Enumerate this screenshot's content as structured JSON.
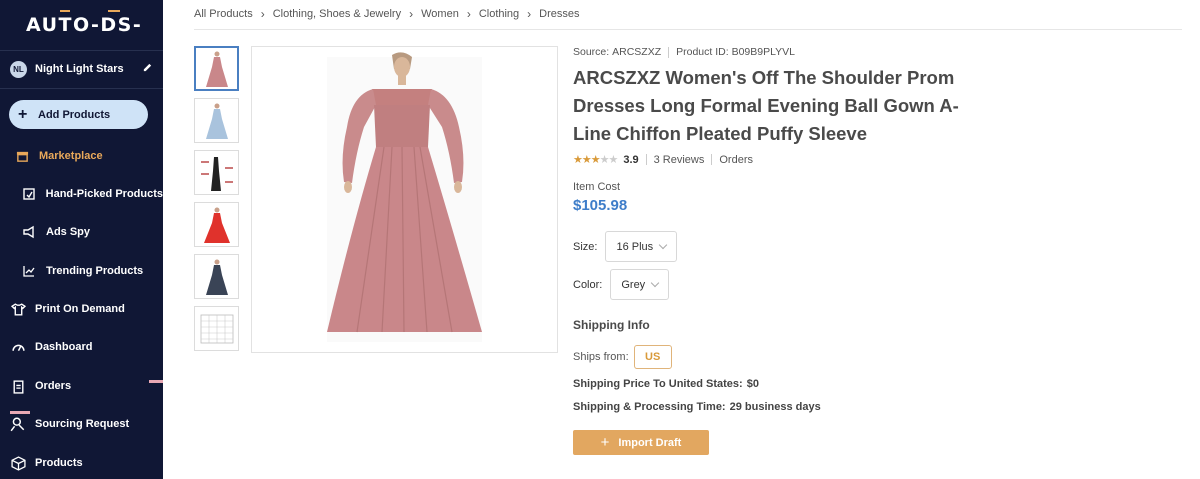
{
  "sidebar": {
    "logo": "AUTO-DS-",
    "store": {
      "initials": "NL",
      "name": "Night Light Stars"
    },
    "add_products": "Add Products",
    "items": [
      {
        "label": "Marketplace",
        "icon": "store-icon",
        "active": true
      },
      {
        "label": "Hand-Picked Products",
        "icon": "hand-picked-icon"
      },
      {
        "label": "Ads Spy",
        "icon": "megaphone-icon"
      },
      {
        "label": "Trending Products",
        "icon": "trending-chart-icon"
      },
      {
        "label": "Print On Demand",
        "icon": "shirt-icon"
      },
      {
        "label": "Dashboard",
        "icon": "gauge-icon"
      },
      {
        "label": "Orders",
        "icon": "clipboard-icon"
      },
      {
        "label": "Sourcing Request",
        "icon": "sourcing-icon"
      },
      {
        "label": "Products",
        "icon": "box-icon"
      }
    ]
  },
  "breadcrumb": [
    "All Products",
    "Clothing, Shoes & Jewelry",
    "Women",
    "Clothing",
    "Dresses"
  ],
  "product": {
    "source_label": "Source:",
    "source": "ARCSZXZ",
    "id_label": "Product ID:",
    "id": "B09B9PLYVL",
    "title": "ARCSZXZ Women's Off The Shoulder Prom Dresses Long Formal Evening Ball Gown A-Line Chiffon Pleated Puffy Sleeve",
    "rating": "3.9",
    "rating_value": 3.9,
    "reviews": "3 Reviews",
    "orders": "Orders",
    "cost_label": "Item Cost",
    "cost": "$105.98",
    "size_label": "Size:",
    "size": "16 Plus",
    "color_label": "Color:",
    "color": "Grey"
  },
  "shipping": {
    "heading": "Shipping Info",
    "ships_from_label": "Ships from:",
    "ships_from": "US",
    "price_label": "Shipping Price To United States:",
    "price": "$0",
    "time_label": "Shipping & Processing Time:",
    "time": "29 business days"
  },
  "import_button": "Import Draft",
  "colors": {
    "sidebar": "#101735",
    "accent": "#e2a760",
    "price": "#3e7dc9",
    "dress": "#c9878a"
  }
}
